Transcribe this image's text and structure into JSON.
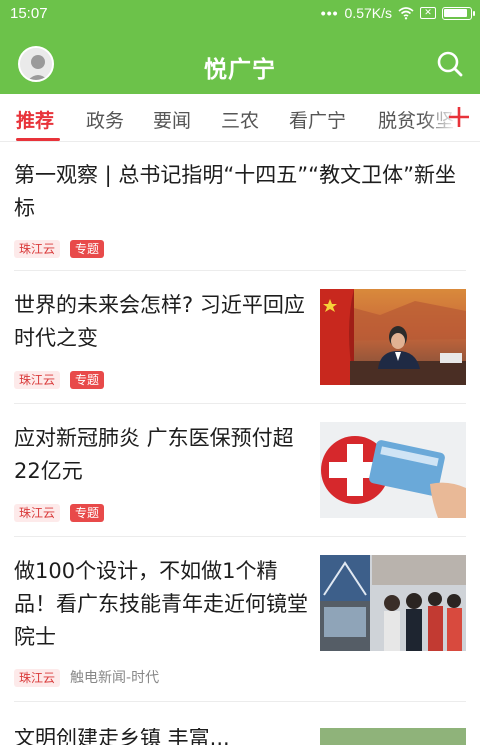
{
  "status_bar": {
    "time": "15:07",
    "network_speed": "0.57K/s",
    "icons": [
      "signal-dots-icon",
      "wifi-icon",
      "sim-disabled-icon",
      "battery-icon"
    ],
    "battery_level": 0.95
  },
  "app_bar": {
    "title": "悦广宁",
    "avatar_icon": "user-avatar-icon",
    "search_icon": "search-icon",
    "background_color": "#6cc24a"
  },
  "tabs": {
    "items": [
      "推荐",
      "政务",
      "要闻",
      "三农",
      "看广宁",
      "脱贫攻坚"
    ],
    "active_index": 0,
    "add_icon": "plus-icon",
    "active_color": "#e8333a"
  },
  "feed": [
    {
      "title": "第一观察 | 总书记指明“十四五”“教文卫体”新坐标",
      "source": "珠江云",
      "badge": "专题"
    },
    {
      "title": "世界的未来会怎样? 习近平回应时代之变",
      "source": "珠江云",
      "badge": "专题",
      "image": "speaker-at-desk-with-flag-image"
    },
    {
      "title": "应对新冠肺炎 广东医保预付超22亿元",
      "source": "珠江云",
      "badge": "专题",
      "image": "medical-card-hospital-cross-image"
    },
    {
      "title": "做100个设计，不如做1个精品！看广东技能青年走近何镜堂院士",
      "source": "珠江云",
      "meta": "触电新闻-时代",
      "image": "architecture-exhibition-image"
    }
  ],
  "partial_next_item_title": "文明创建走乡镇 丰富..."
}
